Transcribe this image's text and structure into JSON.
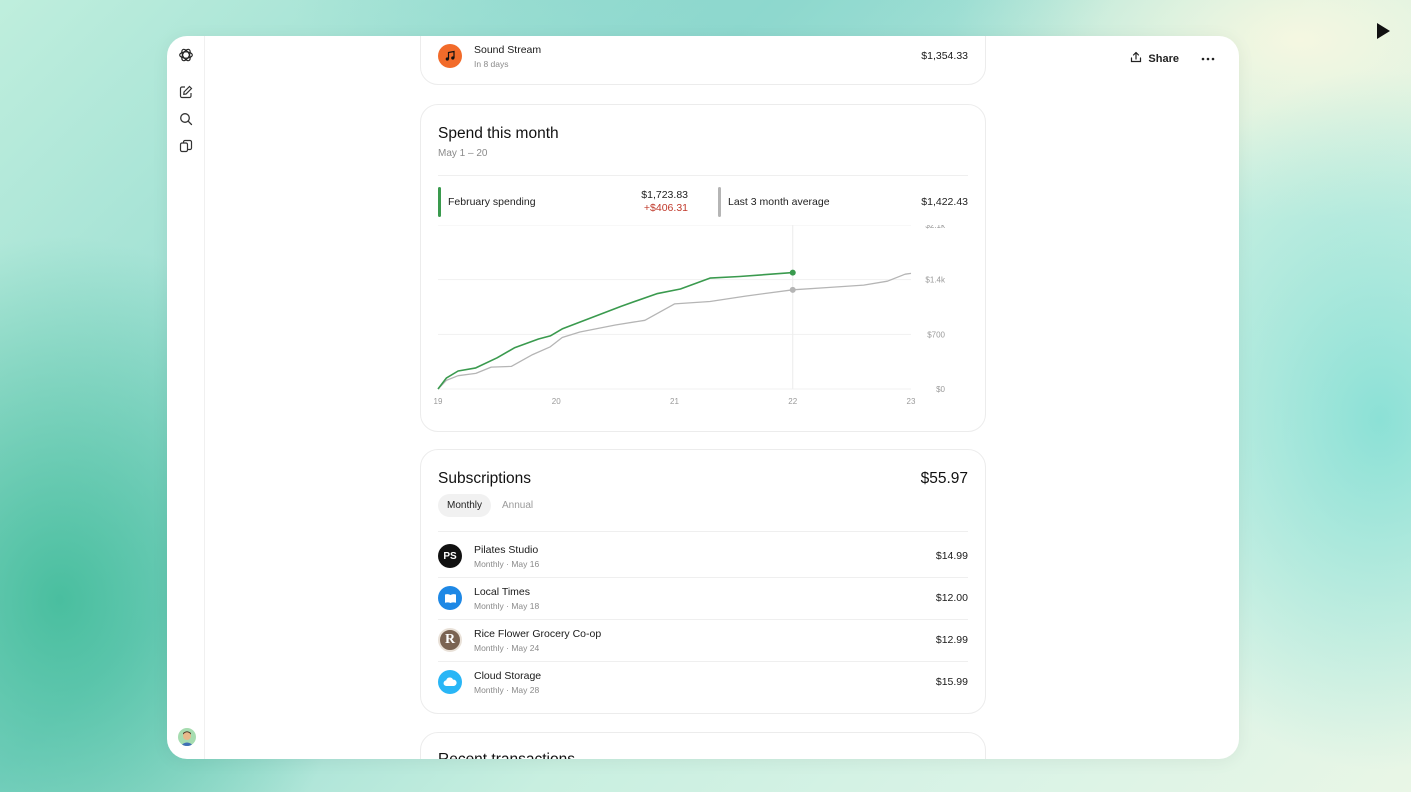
{
  "header": {
    "share_label": "Share"
  },
  "upcoming": {
    "name": "Sound Stream",
    "sub": "In 8 days",
    "amount": "$1,354.33"
  },
  "spend": {
    "title": "Spend this month",
    "range": "May 1 – 20",
    "stat_current": {
      "label": "February spending",
      "value": "$1,723.83",
      "delta": "+$406.31",
      "color": "#3a9a4e"
    },
    "stat_average": {
      "label": "Last 3 month average",
      "value": "$1,422.43",
      "color": "#b5b5b5"
    }
  },
  "chart_data": {
    "type": "line",
    "x_ticks": [
      "19",
      "20",
      "21",
      "22",
      "23"
    ],
    "y_ticks": [
      "$0",
      "$700",
      "$1.4k",
      "$2.1k"
    ],
    "xlim": [
      19,
      23
    ],
    "ylim": [
      0,
      2100
    ],
    "cursor_x": 22,
    "series": [
      {
        "color": "#3a9a4e",
        "x": [
          19,
          19.07,
          19.17,
          19.32,
          19.5,
          19.65,
          19.85,
          19.95,
          20.05,
          20.55,
          20.85,
          21.05,
          21.3,
          21.55,
          22.0
        ],
        "y": [
          0,
          140,
          230,
          270,
          400,
          530,
          640,
          680,
          770,
          1060,
          1220,
          1280,
          1420,
          1440,
          1490
        ]
      },
      {
        "color": "#b5b5b5",
        "x": [
          19,
          19.07,
          19.17,
          19.32,
          19.45,
          19.62,
          19.8,
          19.95,
          20.05,
          20.2,
          20.5,
          20.75,
          21.0,
          21.3,
          21.6,
          22.0,
          22.3,
          22.6,
          22.8,
          22.95,
          23.0
        ],
        "y": [
          0,
          110,
          170,
          200,
          280,
          290,
          440,
          540,
          660,
          730,
          820,
          880,
          1090,
          1120,
          1190,
          1270,
          1300,
          1330,
          1380,
          1470,
          1480
        ]
      }
    ]
  },
  "subscriptions": {
    "title": "Subscriptions",
    "total": "$55.97",
    "tabs": [
      "Monthly",
      "Annual"
    ],
    "items": [
      {
        "name": "Pilates Studio",
        "sub": "Monthly · May 16",
        "amount": "$14.99",
        "logo_text": "PS",
        "logo_color": "#111111"
      },
      {
        "name": "Local Times",
        "sub": "Monthly · May 18",
        "amount": "$12.00",
        "logo_text": "",
        "logo_color": "#1e88e5"
      },
      {
        "name": "Rice Flower Grocery Co-op",
        "sub": "Monthly · May 24",
        "amount": "$12.99",
        "logo_text": "R",
        "logo_color": "#7a6352"
      },
      {
        "name": "Cloud Storage",
        "sub": "Monthly · May 28",
        "amount": "$15.99",
        "logo_text": "",
        "logo_color": "#29b6f6"
      }
    ]
  },
  "recent": {
    "title": "Recent transactions"
  },
  "icons": [
    "openai-logo-icon",
    "new-chat-icon",
    "search-icon",
    "library-icon",
    "play-icon",
    "share-icon",
    "more-icon",
    "music-note-icon",
    "book-icon",
    "cloud-icon"
  ]
}
